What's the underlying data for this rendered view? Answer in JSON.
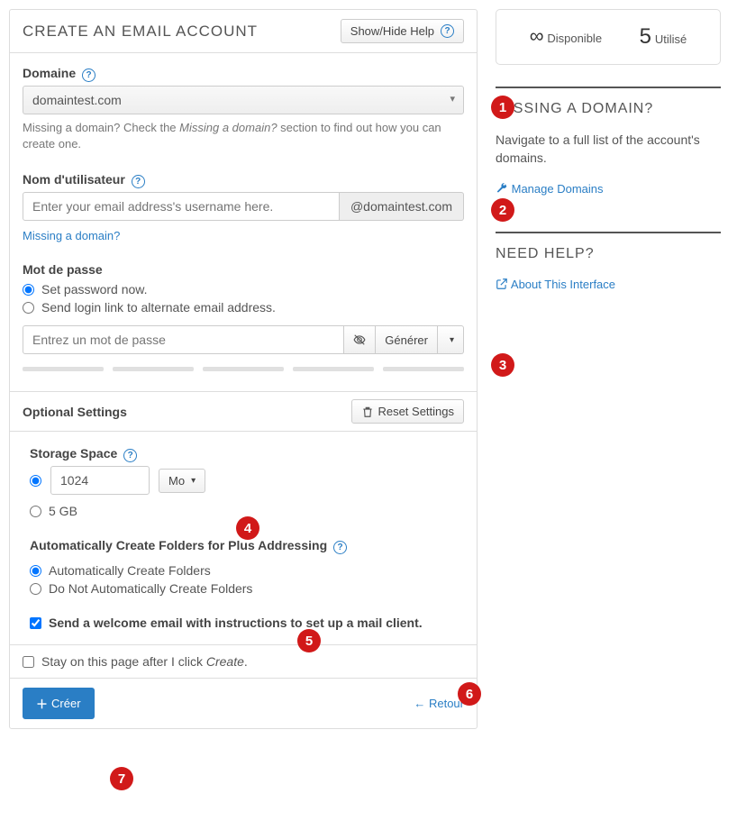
{
  "header": {
    "title": "Create an Email Account",
    "help_btn": "Show/Hide Help"
  },
  "domain": {
    "label": "Domaine",
    "value": "domaintest.com",
    "help_pre": "Missing a domain? Check the ",
    "help_em": "Missing a domain?",
    "help_post": " section to find out how you can create one."
  },
  "username": {
    "label": "Nom d'utilisateur",
    "placeholder": "Enter your email address's username here.",
    "suffix": "@domaintest.com",
    "missing_link": "Missing a domain?"
  },
  "password": {
    "label": "Mot de passe",
    "opt_now": "Set password now.",
    "opt_link": "Send login link to alternate email address.",
    "placeholder": "Entrez un mot de passe",
    "gen_btn": "Générer"
  },
  "optional": {
    "title": "Optional Settings",
    "reset_btn": "Reset Settings",
    "storage": {
      "label": "Storage Space",
      "value": "1024",
      "unit": "Mo",
      "alt": "5 GB"
    },
    "folders": {
      "label": "Automatically Create Folders for Plus Addressing",
      "opt_auto": "Automatically Create Folders",
      "opt_no": "Do Not Automatically Create Folders"
    },
    "welcome": "Send a welcome email with instructions to set up a mail client."
  },
  "footer": {
    "stay_pre": "Stay on this page after I click ",
    "stay_em": "Create",
    "create_btn": "Créer",
    "back_btn": "Retour"
  },
  "side": {
    "stat_avail_lbl": "Disponible",
    "stat_used_num": "5",
    "stat_used_lbl": "Utilisé",
    "missing_head": "Missing a Domain?",
    "missing_text": "Navigate to a full list of the account's domains.",
    "manage_link": "Manage Domains",
    "help_head": "Need Help?",
    "about_link": "About This Interface"
  },
  "badges": [
    "1",
    "2",
    "3",
    "4",
    "5",
    "6",
    "7"
  ]
}
